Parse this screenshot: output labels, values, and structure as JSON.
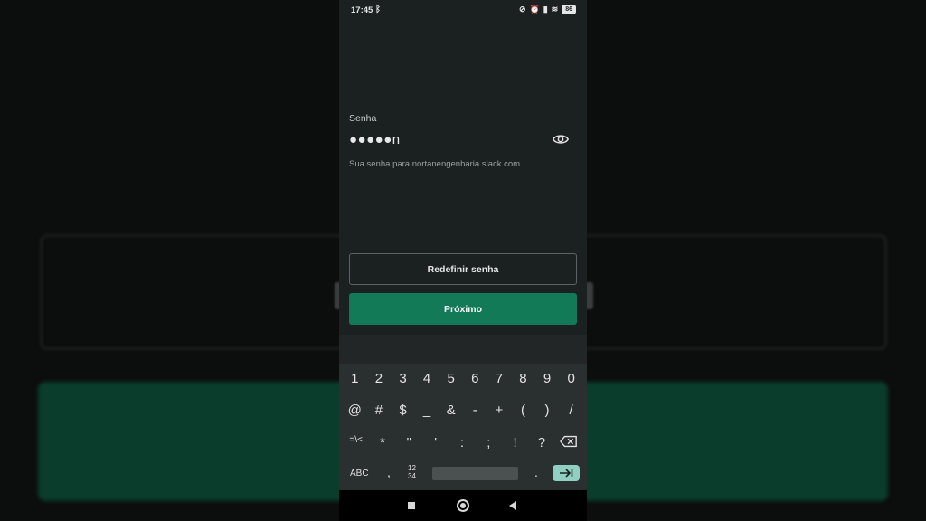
{
  "status_bar": {
    "time": "17:45",
    "battery": "86",
    "icons": [
      "bluetooth-icon",
      "mute-icon",
      "alarm-icon",
      "signal-icon",
      "wifi-icon",
      "battery-icon"
    ]
  },
  "form": {
    "label": "Senha",
    "password_value": "●●●●●n",
    "hint": "Sua senha para nortanengenharia.slack.com.",
    "reset_button": "Redefinir senha",
    "next_button": "Próximo"
  },
  "keyboard": {
    "row1": [
      "1",
      "2",
      "3",
      "4",
      "5",
      "6",
      "7",
      "8",
      "9",
      "0"
    ],
    "row2": [
      "@",
      "#",
      "$",
      "_",
      "&",
      "-",
      "+",
      "(",
      ")",
      "/"
    ],
    "row3": [
      "=\\<",
      "*",
      "\"",
      "'",
      ":",
      ";",
      "!",
      "?"
    ],
    "abc": "ABC",
    "comma": ",",
    "num_top": "12",
    "num_bottom": "34",
    "dot": "."
  },
  "colors": {
    "accent": "#137a57",
    "background": "#1b2121",
    "enter_key": "#8fd0c2"
  }
}
